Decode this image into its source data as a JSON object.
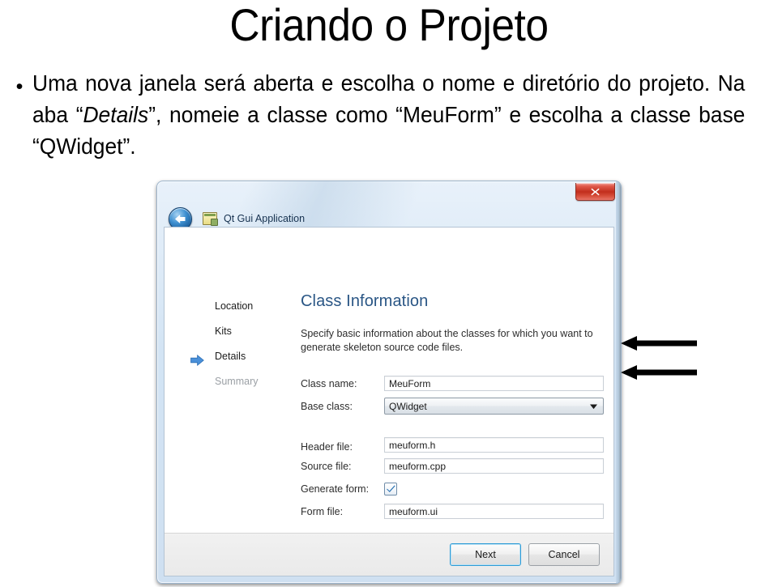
{
  "slide": {
    "title": "Criando o Projeto",
    "bullet_marker": "•",
    "bullet_html": "Uma nova janela será aberta e escolha o nome e diretório do projeto. Na aba “<i>Details</i>”, nomeie a classe como “MeuForm” e escolha a classe base “QWidget”."
  },
  "dialog": {
    "titlebar": {
      "app_title": "Qt Gui Application",
      "back_icon": "back-arrow-icon",
      "app_icon": "qt-window-icon",
      "close_label": "x"
    },
    "nav": {
      "items": [
        {
          "label": "Location",
          "state": "normal",
          "current": false
        },
        {
          "label": "Kits",
          "state": "normal",
          "current": false
        },
        {
          "label": "Details",
          "state": "normal",
          "current": true
        },
        {
          "label": "Summary",
          "state": "dim",
          "current": false
        }
      ]
    },
    "content": {
      "heading": "Class Information",
      "description": "Specify basic information about the classes for which you want to generate skeleton source code files."
    },
    "fields": {
      "class_name": {
        "label": "Class name:",
        "value": "MeuForm",
        "type": "text"
      },
      "base_class": {
        "label": "Base class:",
        "value": "QWidget",
        "type": "combobox"
      },
      "header_file": {
        "label": "Header file:",
        "value": "meuform.h",
        "type": "text"
      },
      "source_file": {
        "label": "Source file:",
        "value": "meuform.cpp",
        "type": "text"
      },
      "generate_form": {
        "label": "Generate form:",
        "value": "checked",
        "type": "checkbox"
      },
      "form_file": {
        "label": "Form file:",
        "value": "meuform.ui",
        "type": "text"
      }
    },
    "buttons": {
      "next": "Next",
      "cancel": "Cancel"
    }
  },
  "annotations": {
    "arrow_1": "pointer-arrow-class-name",
    "arrow_2": "pointer-arrow-base-class"
  },
  "colors": {
    "heading_blue": "#2a5685",
    "titlebar_blue": "#d3e4f4",
    "close_red": "#c22e1d",
    "default_button_border": "#2e9bd6",
    "dim_text": "#9ba0a5",
    "arrow_black": "#000000"
  }
}
